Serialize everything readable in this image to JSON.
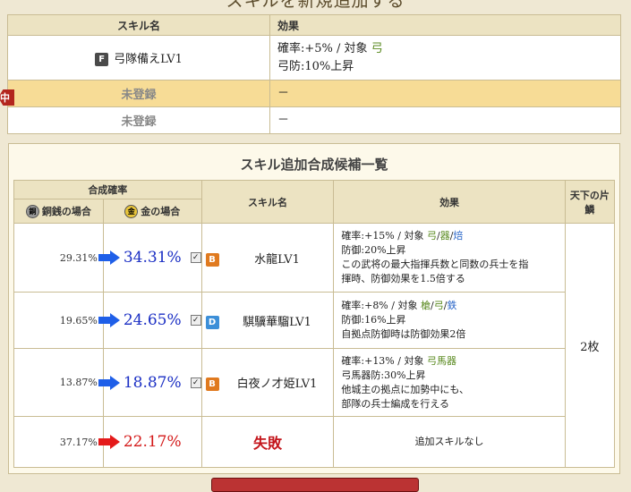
{
  "page_title": "スキルを新規追加する",
  "skill_table": {
    "col_name": "スキル名",
    "col_effect": "効果",
    "rows": [
      {
        "badge": "F",
        "name": "弓隊備えLV1",
        "effect_line1_prefix": "確率:+5% / 対象 ",
        "effect_line1_target": "弓",
        "effect_line2": "弓防:10%上昇"
      },
      {
        "name": "未登録",
        "effect": "－"
      },
      {
        "name": "未登録",
        "effect": "－"
      }
    ],
    "marker": "中"
  },
  "candidates": {
    "title": "スキル追加合成候補一覧",
    "header_rate": "合成確率",
    "header_copper": "銅銭の場合",
    "header_gold": "金の場合",
    "header_name": "スキル名",
    "header_effect": "効果",
    "header_tenka": "天下の片鱗",
    "coin_copper": "銅",
    "coin_gold": "金",
    "tenka_value": "2枚",
    "rows": [
      {
        "copper": "29.31%",
        "gold": "34.31%",
        "badge": "B",
        "name": "水龍LV1",
        "eff_prefix": "確率:+15% / 対象 ",
        "eff_t1": "弓",
        "eff_sep1": "/",
        "eff_t2": "器",
        "eff_sep2": "/",
        "eff_t3": "焙",
        "eff_lines": [
          "防御:20%上昇",
          "この武将の最大指揮兵数と同数の兵士を指",
          "揮時、防御効果を1.5倍する"
        ]
      },
      {
        "copper": "19.65%",
        "gold": "24.65%",
        "badge": "D",
        "name": "騏驥華騮LV1",
        "eff_prefix": "確率:+8% / 対象 ",
        "eff_t1": "槍",
        "eff_sep1": "/",
        "eff_t2": "弓",
        "eff_sep2": "/",
        "eff_t3": "鉄",
        "eff_lines": [
          "防御:16%上昇",
          "自拠点防御時は防御効果2倍"
        ]
      },
      {
        "copper": "13.87%",
        "gold": "18.87%",
        "badge": "B",
        "name": "白夜ノ才姫LV1",
        "eff_prefix": "確率:+13% / 対象 ",
        "eff_t1": "弓馬器",
        "eff_lines": [
          "弓馬器防:30%上昇",
          "他城主の拠点に加勢中にも、",
          "部隊の兵士編成を行える"
        ]
      },
      {
        "copper": "37.17%",
        "gold": "22.17%",
        "name": "失敗",
        "effect": "追加スキルなし"
      }
    ]
  },
  "colors": {
    "blue_arrow": "#1f5fe8",
    "red_arrow": "#e41a1a",
    "highlight_row": "#f7dc96"
  }
}
